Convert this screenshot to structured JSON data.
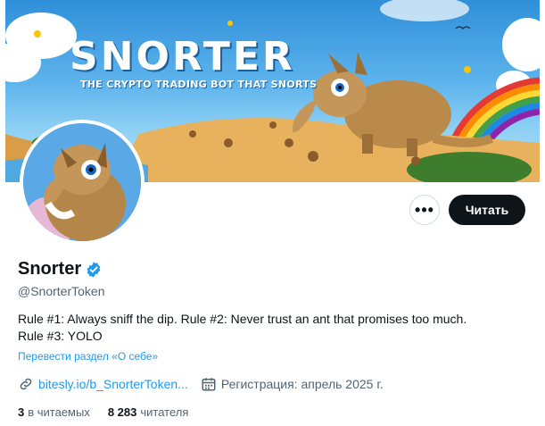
{
  "banner": {
    "title": "SNORTER",
    "subtitle": "THE CRYPTO TRADING BOT THAT SNORTS"
  },
  "actions": {
    "more_label": "•••",
    "follow_label": "Читать"
  },
  "profile": {
    "display_name": "Snorter",
    "handle": "@SnorterToken",
    "verified_color": "#1d9bf0",
    "bio_line1": "Rule #1: Always sniff the dip. Rule #2: Never trust an ant that promises too much.",
    "bio_line2": "Rule #3: YOLO",
    "translate_link": "Перевести раздел «О себе»",
    "website": "bitesly.io/b_SnorterToken...",
    "joined": "Регистрация: апрель 2025 г."
  },
  "stats": {
    "following_count": "3",
    "following_label": "в читаемых",
    "followers_count": "8 283",
    "followers_label": "читателя"
  }
}
